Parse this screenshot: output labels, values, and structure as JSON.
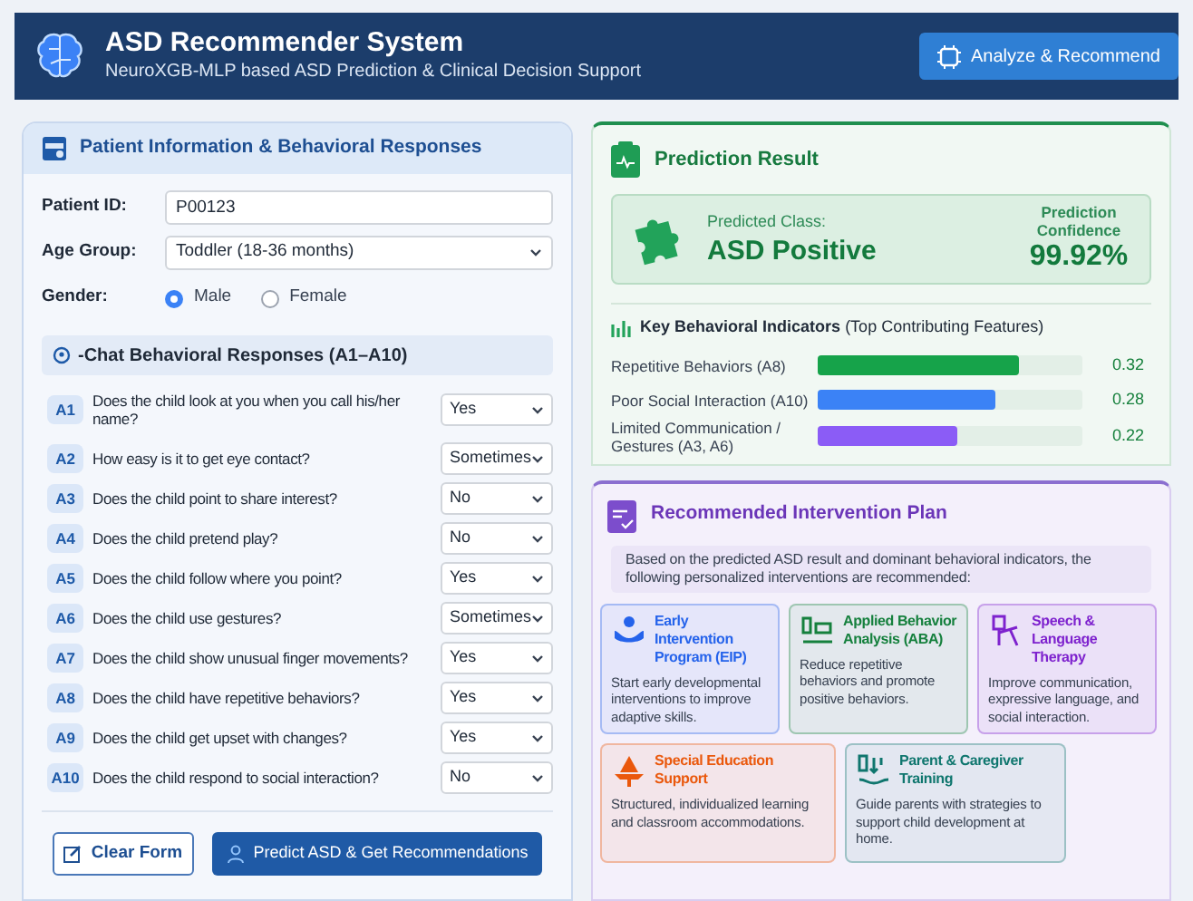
{
  "header": {
    "title": "ASD Recommender System",
    "subtitle": "NeuroXGB-MLP based ASD Prediction & Clinical Decision Support",
    "action": "Analyze & Recommend"
  },
  "patient_panel": {
    "title": "Patient Information & Behavioral Responses",
    "patient_id": {
      "label": "Patient ID:",
      "value": "P00123"
    },
    "age_group": {
      "label": "Age Group:",
      "value": "Toddler (18-36 months)"
    },
    "gender": {
      "label": "Gender:",
      "options": [
        {
          "label": "Male",
          "selected": true
        },
        {
          "label": "Female",
          "selected": false
        }
      ]
    },
    "responses_title": "-Chat Behavioral Responses (A1–A10)",
    "questions": [
      {
        "code": "A1",
        "text": "Does the child look at you when you call his/her name?",
        "answer": "Yes"
      },
      {
        "code": "A2",
        "text": "How easy is it to get eye contact?",
        "answer": "Sometimes"
      },
      {
        "code": "A3",
        "text": "Does the child point to share interest?",
        "answer": "No"
      },
      {
        "code": "A4",
        "text": "Does the child pretend play?",
        "answer": "No"
      },
      {
        "code": "A5",
        "text": "Does the child follow where you point?",
        "answer": "Yes"
      },
      {
        "code": "A6",
        "text": "Does the child use gestures?",
        "answer": "Sometimes"
      },
      {
        "code": "A7",
        "text": "Does the child show unusual finger movements?",
        "answer": "Yes"
      },
      {
        "code": "A8",
        "text": "Does the child have repetitive behaviors?",
        "answer": "Yes"
      },
      {
        "code": "A9",
        "text": "Does the child get upset with changes?",
        "answer": "Yes"
      },
      {
        "code": "A10",
        "text": "Does the child respond to social interaction?",
        "answer": "No"
      }
    ],
    "buttons": [
      "Clear Form",
      "Predict ASD & Get Recommendations"
    ]
  },
  "prediction": {
    "title": "Prediction Result",
    "class_label": "Predicted Class:",
    "class_value": "ASD Positive",
    "confidence_label": "Prediction Confidence",
    "confidence_value": "99.92%",
    "indicators_title": "Key Behavioral Indicators",
    "indicators_subtitle": "(Top Contributing Features)",
    "indicators": [
      {
        "name": "Repetitive Behaviors (A8)",
        "value": "0.32",
        "level": 0.76,
        "color": "#16a34a"
      },
      {
        "name": "Poor Social Interaction (A10)",
        "value": "0.28",
        "level": 0.67,
        "color": "#3b82f6"
      },
      {
        "name": "Limited Communication / Gestures (A3, A6)",
        "value": "0.22",
        "level": 0.53,
        "color": "#8b5cf6"
      }
    ]
  },
  "intervention": {
    "title": "Recommended Intervention Plan",
    "intro": "Based on the predicted ASD result and dominant behavioral indicators, the following personalized interventions are recommended:",
    "cards": [
      {
        "title": "Early Intervention Program (EIP)",
        "text": "Start early developmental interventions to improve adaptive skills.",
        "color": "#2563eb"
      },
      {
        "title": "Applied Behavior Analysis (ABA)",
        "text": "Reduce repetitive behaviors and promote positive behaviors.",
        "color": "#15803d"
      },
      {
        "title": "Speech & Language Therapy",
        "text": "Improve communication, expressive language, and social interaction.",
        "color": "#7e22ce"
      },
      {
        "title": "Special Education Support",
        "text": "Structured, individualized learning and classroom accommodations.",
        "color": "#ea580c"
      },
      {
        "title": "Parent & Caregiver Training",
        "text": "Guide parents with strategies to support child development at home.",
        "color": "#0f766e"
      }
    ]
  }
}
